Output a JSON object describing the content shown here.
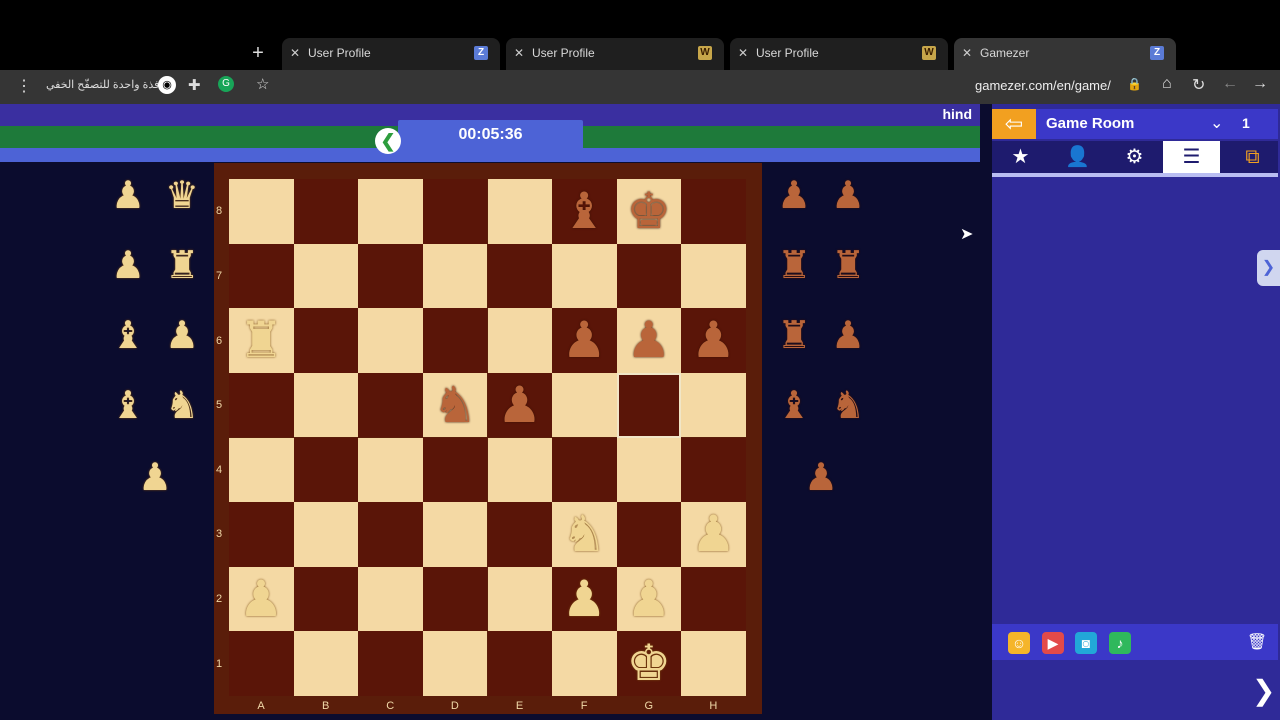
{
  "browser": {
    "tabs": [
      {
        "title": "User Profile",
        "favicon": "Z"
      },
      {
        "title": "User Profile",
        "favicon": "W"
      },
      {
        "title": "User Profile",
        "favicon": "W"
      },
      {
        "title": "Gamezer",
        "favicon": "Z",
        "active": true
      }
    ],
    "incognito_label": "نافذة واحدة للتصفّح الخفي",
    "url": "gamezer.com/en/game/"
  },
  "game": {
    "player_name": "hind",
    "timer": "00:05:36",
    "ranks": [
      "8",
      "7",
      "6",
      "5",
      "4",
      "3",
      "2",
      "1"
    ],
    "files": [
      "A",
      "B",
      "C",
      "D",
      "E",
      "F",
      "G",
      "H"
    ],
    "pieces": [
      {
        "square": "f8",
        "glyph": "♝",
        "color": "black"
      },
      {
        "square": "g8",
        "glyph": "♚",
        "color": "black"
      },
      {
        "square": "a6",
        "glyph": "♜",
        "color": "white"
      },
      {
        "square": "f6",
        "glyph": "♟",
        "color": "black"
      },
      {
        "square": "g6",
        "glyph": "♟",
        "color": "black"
      },
      {
        "square": "h6",
        "glyph": "♟",
        "color": "black"
      },
      {
        "square": "d5",
        "glyph": "♞",
        "color": "black"
      },
      {
        "square": "e5",
        "glyph": "♟",
        "color": "black"
      },
      {
        "square": "f3",
        "glyph": "♞",
        "color": "white"
      },
      {
        "square": "h3",
        "glyph": "♟",
        "color": "white"
      },
      {
        "square": "a2",
        "glyph": "♟",
        "color": "white"
      },
      {
        "square": "f2",
        "glyph": "♟",
        "color": "white"
      },
      {
        "square": "g2",
        "glyph": "♟",
        "color": "white"
      },
      {
        "square": "g1",
        "glyph": "♚",
        "color": "white"
      }
    ],
    "highlight": "g5",
    "captured_left": [
      "♟",
      "♛",
      "♟",
      "♜",
      "♝",
      "♟",
      "♝",
      "♞",
      "♟"
    ],
    "captured_right": [
      "♟",
      "♟",
      "♜",
      "♜",
      "♜",
      "♟",
      "♝",
      "♞",
      "♟"
    ]
  },
  "panel": {
    "title": "Game Room",
    "room_number": "1"
  }
}
